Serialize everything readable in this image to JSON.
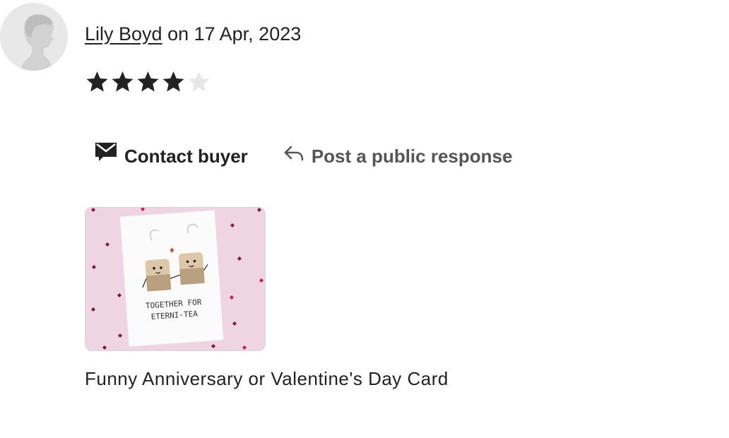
{
  "review": {
    "reviewer_name": "Lily Boyd",
    "date_text": "on 17 Apr, 2023",
    "rating": 4,
    "rating_max": 5
  },
  "actions": {
    "contact_label": "Contact buyer",
    "respond_label": "Post a public response"
  },
  "product": {
    "title": "Funny Anniversary or Valentine's Day Card",
    "card_text_line1": "TOGETHER FOR",
    "card_text_line2": "ETERNI-TEA"
  },
  "icons": {
    "avatar": "default-avatar-icon",
    "contact": "mail-icon",
    "respond": "reply-icon",
    "star_filled": "star-filled-icon",
    "star_empty": "star-empty-icon"
  },
  "colors": {
    "star_filled": "#222222",
    "star_empty": "#e6e6e6",
    "thumb_background": "#f0d6e4"
  }
}
